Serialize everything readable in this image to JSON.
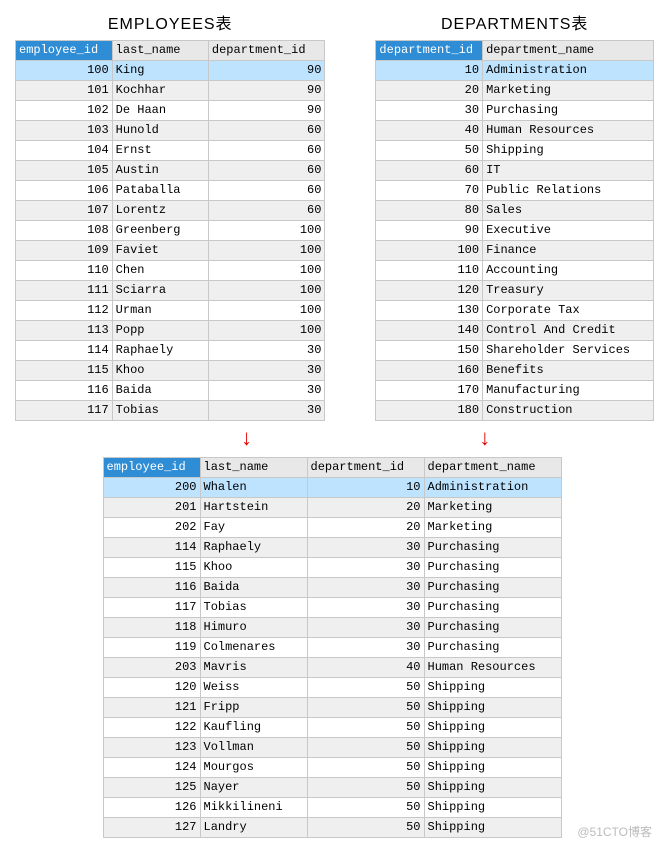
{
  "employees": {
    "title": "EMPLOYEES表",
    "headers": [
      "employee_id",
      "last_name",
      "department_id"
    ],
    "selected_header_idx": 0,
    "rows": [
      {
        "employee_id": 100,
        "last_name": "King",
        "department_id": 90,
        "selected": true
      },
      {
        "employee_id": 101,
        "last_name": "Kochhar",
        "department_id": 90
      },
      {
        "employee_id": 102,
        "last_name": "De Haan",
        "department_id": 90
      },
      {
        "employee_id": 103,
        "last_name": "Hunold",
        "department_id": 60
      },
      {
        "employee_id": 104,
        "last_name": "Ernst",
        "department_id": 60
      },
      {
        "employee_id": 105,
        "last_name": "Austin",
        "department_id": 60
      },
      {
        "employee_id": 106,
        "last_name": "Pataballa",
        "department_id": 60
      },
      {
        "employee_id": 107,
        "last_name": "Lorentz",
        "department_id": 60
      },
      {
        "employee_id": 108,
        "last_name": "Greenberg",
        "department_id": 100
      },
      {
        "employee_id": 109,
        "last_name": "Faviet",
        "department_id": 100
      },
      {
        "employee_id": 110,
        "last_name": "Chen",
        "department_id": 100
      },
      {
        "employee_id": 111,
        "last_name": "Sciarra",
        "department_id": 100
      },
      {
        "employee_id": 112,
        "last_name": "Urman",
        "department_id": 100
      },
      {
        "employee_id": 113,
        "last_name": "Popp",
        "department_id": 100
      },
      {
        "employee_id": 114,
        "last_name": "Raphaely",
        "department_id": 30
      },
      {
        "employee_id": 115,
        "last_name": "Khoo",
        "department_id": 30
      },
      {
        "employee_id": 116,
        "last_name": "Baida",
        "department_id": 30
      },
      {
        "employee_id": 117,
        "last_name": "Tobias",
        "department_id": 30
      }
    ]
  },
  "departments": {
    "title": "DEPARTMENTS表",
    "headers": [
      "department_id",
      "department_name"
    ],
    "selected_header_idx": 0,
    "rows": [
      {
        "department_id": 10,
        "department_name": "Administration",
        "selected": true
      },
      {
        "department_id": 20,
        "department_name": "Marketing"
      },
      {
        "department_id": 30,
        "department_name": "Purchasing"
      },
      {
        "department_id": 40,
        "department_name": "Human Resources"
      },
      {
        "department_id": 50,
        "department_name": "Shipping"
      },
      {
        "department_id": 60,
        "department_name": "IT"
      },
      {
        "department_id": 70,
        "department_name": "Public Relations"
      },
      {
        "department_id": 80,
        "department_name": "Sales"
      },
      {
        "department_id": 90,
        "department_name": "Executive"
      },
      {
        "department_id": 100,
        "department_name": "Finance"
      },
      {
        "department_id": 110,
        "department_name": "Accounting"
      },
      {
        "department_id": 120,
        "department_name": "Treasury"
      },
      {
        "department_id": 130,
        "department_name": "Corporate Tax"
      },
      {
        "department_id": 140,
        "department_name": "Control And Credit"
      },
      {
        "department_id": 150,
        "department_name": "Shareholder Services"
      },
      {
        "department_id": 160,
        "department_name": "Benefits"
      },
      {
        "department_id": 170,
        "department_name": "Manufacturing"
      },
      {
        "department_id": 180,
        "department_name": "Construction"
      }
    ]
  },
  "joined": {
    "headers": [
      "employee_id",
      "last_name",
      "department_id",
      "department_name"
    ],
    "selected_header_idx": 0,
    "rows": [
      {
        "employee_id": 200,
        "last_name": "Whalen",
        "department_id": 10,
        "department_name": "Administration",
        "selected": true
      },
      {
        "employee_id": 201,
        "last_name": "Hartstein",
        "department_id": 20,
        "department_name": "Marketing"
      },
      {
        "employee_id": 202,
        "last_name": "Fay",
        "department_id": 20,
        "department_name": "Marketing"
      },
      {
        "employee_id": 114,
        "last_name": "Raphaely",
        "department_id": 30,
        "department_name": "Purchasing"
      },
      {
        "employee_id": 115,
        "last_name": "Khoo",
        "department_id": 30,
        "department_name": "Purchasing"
      },
      {
        "employee_id": 116,
        "last_name": "Baida",
        "department_id": 30,
        "department_name": "Purchasing"
      },
      {
        "employee_id": 117,
        "last_name": "Tobias",
        "department_id": 30,
        "department_name": "Purchasing"
      },
      {
        "employee_id": 118,
        "last_name": "Himuro",
        "department_id": 30,
        "department_name": "Purchasing"
      },
      {
        "employee_id": 119,
        "last_name": "Colmenares",
        "department_id": 30,
        "department_name": "Purchasing"
      },
      {
        "employee_id": 203,
        "last_name": "Mavris",
        "department_id": 40,
        "department_name": "Human Resources"
      },
      {
        "employee_id": 120,
        "last_name": "Weiss",
        "department_id": 50,
        "department_name": "Shipping"
      },
      {
        "employee_id": 121,
        "last_name": "Fripp",
        "department_id": 50,
        "department_name": "Shipping"
      },
      {
        "employee_id": 122,
        "last_name": "Kaufling",
        "department_id": 50,
        "department_name": "Shipping"
      },
      {
        "employee_id": 123,
        "last_name": "Vollman",
        "department_id": 50,
        "department_name": "Shipping"
      },
      {
        "employee_id": 124,
        "last_name": "Mourgos",
        "department_id": 50,
        "department_name": "Shipping"
      },
      {
        "employee_id": 125,
        "last_name": "Nayer",
        "department_id": 50,
        "department_name": "Shipping"
      },
      {
        "employee_id": 126,
        "last_name": "Mikkilineni",
        "department_id": 50,
        "department_name": "Shipping"
      },
      {
        "employee_id": 127,
        "last_name": "Landry",
        "department_id": 50,
        "department_name": "Shipping"
      }
    ]
  },
  "colwidths": {
    "employees": [
      90,
      90,
      110
    ],
    "departments": [
      100,
      165
    ],
    "joined": [
      90,
      100,
      110,
      130
    ]
  },
  "arrow_glyph": "↓",
  "watermark": "@51CTO博客"
}
